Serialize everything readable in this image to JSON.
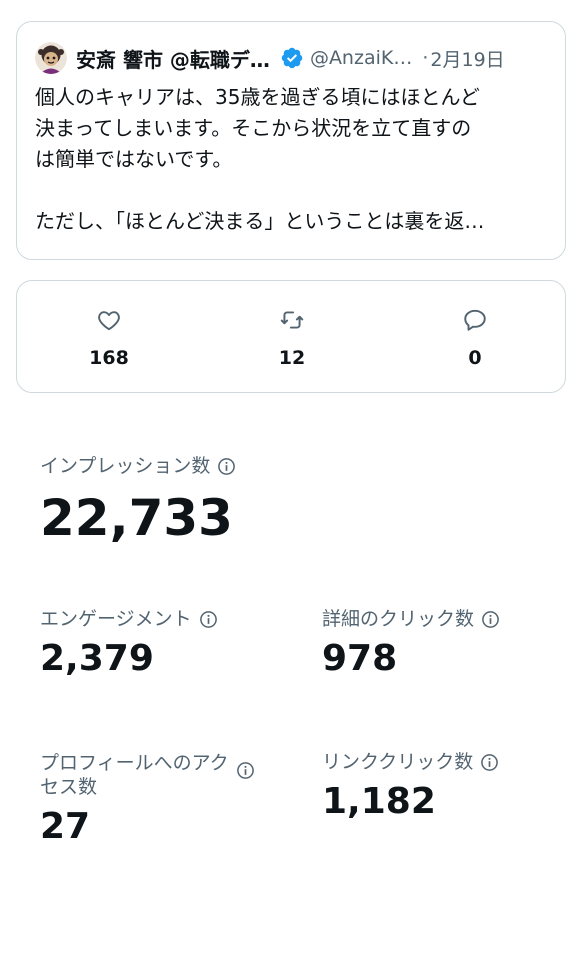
{
  "tweet": {
    "author_name": "安斎 響市 @転職デ…",
    "handle": "@AnzaiK…",
    "separator": "·",
    "date": "2月19日",
    "text_lines": [
      "個人のキャリアは、35歳を過ぎる頃にはほとんど",
      "決まってしまいます。そこから状況を立て直すの",
      "は簡単ではないです。",
      "ただし、「ほとんど決まる」ということは裏を返…"
    ]
  },
  "engagement": {
    "likes": "168",
    "retweets": "12",
    "replies": "0"
  },
  "metrics": {
    "impressions": {
      "label": "インプレッション数",
      "value": "22,733"
    },
    "engagements": {
      "label": "エンゲージメント",
      "value": "2,379"
    },
    "detail_clicks": {
      "label": "詳細のクリック数",
      "value": "978"
    },
    "profile_visits": {
      "label_line1": "プロフィールへのアク",
      "label_line2": "セス数",
      "value": "27"
    },
    "link_clicks": {
      "label": "リンククリック数",
      "value": "1,182"
    }
  },
  "colors": {
    "text_primary": "#0f1419",
    "text_secondary": "#536471",
    "border": "#cfd9de",
    "verified_blue": "#1d9bf0"
  },
  "icons": {
    "like": "heart-icon",
    "retweet": "retweet-icon",
    "reply": "reply-icon",
    "info": "info-icon",
    "verified": "verified-badge-icon"
  }
}
